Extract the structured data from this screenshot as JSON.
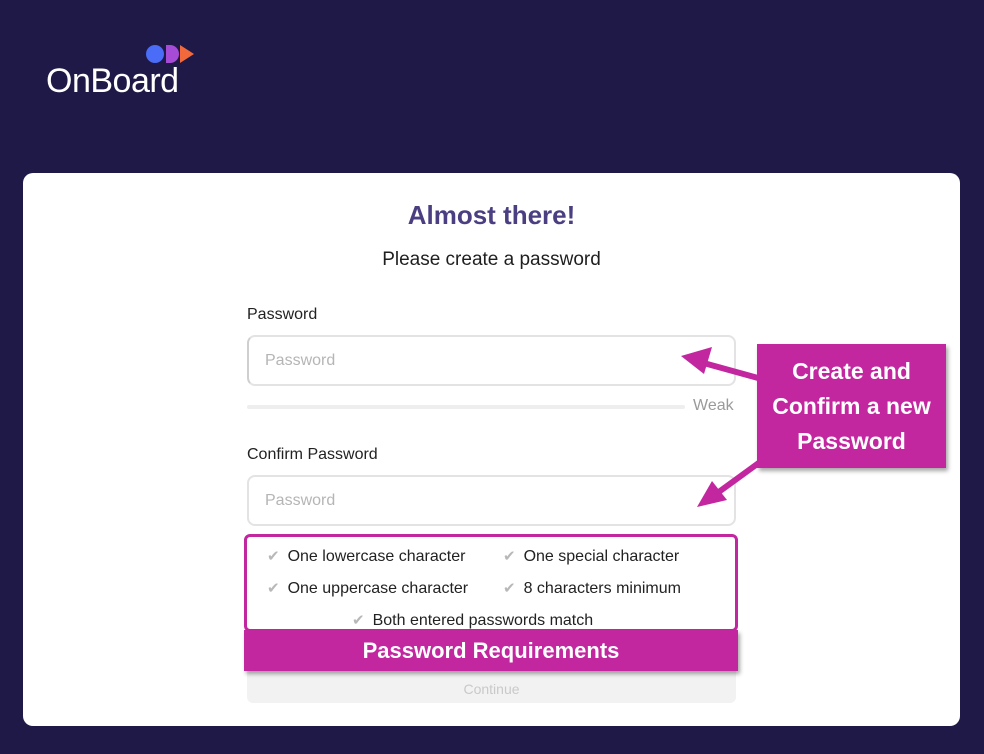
{
  "brand": {
    "name": "OnBoard"
  },
  "card": {
    "title": "Almost there!",
    "subtitle": "Please create a password"
  },
  "password": {
    "label": "Password",
    "placeholder": "Password",
    "strength": "Weak"
  },
  "confirm": {
    "label": "Confirm Password",
    "placeholder": "Password"
  },
  "requirements": {
    "lowercase": "One lowercase character",
    "special": "One special character",
    "uppercase": "One uppercase character",
    "minimum": "8 characters minimum",
    "match": "Both entered passwords match"
  },
  "continue_label": "Continue",
  "annotations": {
    "callout_line1": "Create and",
    "callout_line2": "Confirm a new",
    "callout_line3": "Password",
    "banner": "Password Requirements"
  },
  "colors": {
    "background": "#1f1947",
    "title": "#4b3f82",
    "annotation": "#c227a0",
    "logo_blue": "#4a6cf7",
    "logo_purple": "#a64bd6",
    "logo_orange": "#f2693b"
  }
}
